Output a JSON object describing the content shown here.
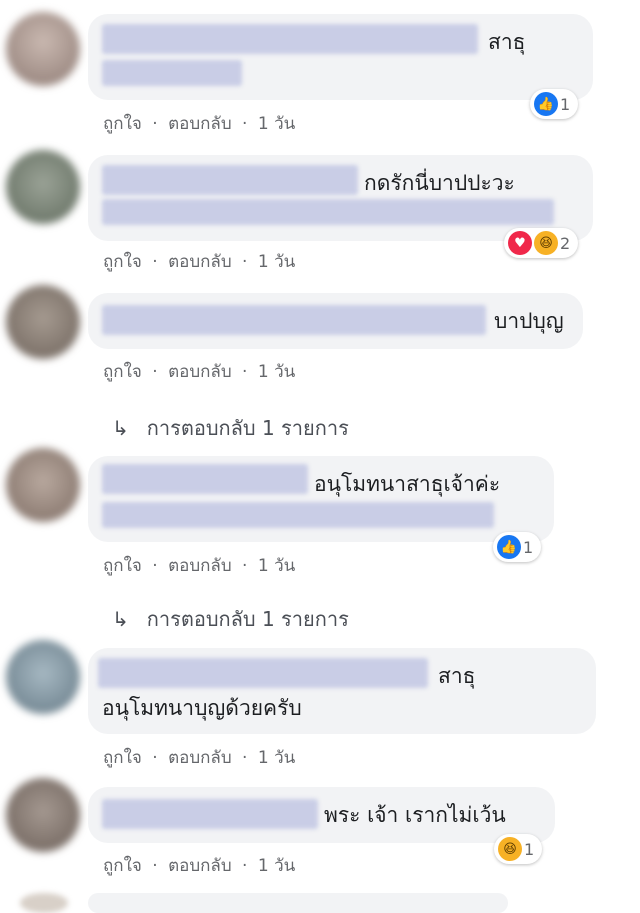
{
  "action_labels": {
    "like": "ถูกใจ",
    "reply": "ตอบกลับ",
    "separator": "·"
  },
  "comments": [
    {
      "text_lines": [
        "สาธุ"
      ],
      "time": "1 วัน",
      "reactions": {
        "icons": [
          "like"
        ],
        "count": "1"
      }
    },
    {
      "text_lines": [
        "กดรักนี่บาปปะวะ"
      ],
      "time": "1 วัน",
      "reactions": {
        "icons": [
          "love",
          "haha"
        ],
        "count": "2"
      }
    },
    {
      "text_lines": [
        "บาปบุญ"
      ],
      "time": "1 วัน",
      "reactions": null
    },
    {
      "text_lines": [
        "อนุโมทนาสาธุเจ้าค่ะ"
      ],
      "time": "1 วัน",
      "reactions": {
        "icons": [
          "like"
        ],
        "count": "1"
      }
    },
    {
      "text_lines": [
        "สาธุ",
        "อนุโมทนาบุญด้วยครับ"
      ],
      "time": "1 วัน",
      "reactions": null
    },
    {
      "text_lines": [
        "พระ เจ้า เรากไม่เว้น"
      ],
      "time": "1 วัน",
      "reactions": {
        "icons": [
          "haha"
        ],
        "count": "1"
      }
    }
  ],
  "reply_links": [
    {
      "label": "การตอบกลับ 1 รายการ"
    },
    {
      "label": "การตอบกลับ 1 รายการ"
    }
  ],
  "colors": {
    "bubble": "#f2f3f5",
    "like": "#1877f2",
    "love": "#f0284a",
    "haha": "#f7b125",
    "meta_text": "#65676b"
  }
}
